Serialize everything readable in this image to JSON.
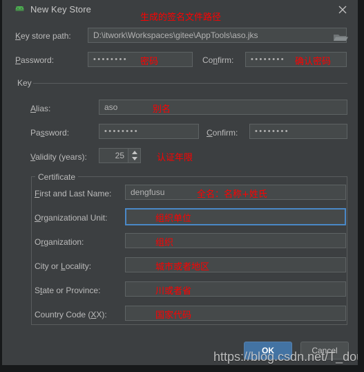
{
  "window": {
    "title": "New Key Store",
    "app_icon": "android-robot-icon",
    "close_icon": "close-icon"
  },
  "keystore": {
    "path_label": "Key store path:",
    "path_label_mnemonic": "K",
    "path_value": "D:\\itwork\\Workspaces\\gitee\\AppTools\\aso.jks",
    "path_annotation": "生成的签名文件路径",
    "browse_icon": "folder-icon",
    "password_label": "Password:",
    "password_label_mnemonic": "P",
    "password_value": "••••••••",
    "password_annotation": "密码",
    "confirm_label": "Confirm:",
    "confirm_label_mnemonic": "n",
    "confirm_value": "••••••••",
    "confirm_annotation": "确认密码"
  },
  "key": {
    "group_title": "Key",
    "alias_label": "Alias:",
    "alias_label_mnemonic": "A",
    "alias_value": "aso",
    "alias_annotation": "别名",
    "password_label": "Password:",
    "password_label_mnemonic": "s",
    "password_value": "••••••••",
    "confirm_label": "Confirm:",
    "confirm_label_mnemonic": "C",
    "confirm_value": "••••••••",
    "validity_label": "Validity (years):",
    "validity_label_mnemonic": "V",
    "validity_value": "25",
    "validity_annotation": "认证年限"
  },
  "certificate": {
    "group_title": "Certificate",
    "rows": [
      {
        "label": "First and Last Name:",
        "mnemonic": "F",
        "value": "dengfusu",
        "annotation": "全名：名称+姓氏",
        "focused": false
      },
      {
        "label": "Organizational Unit:",
        "mnemonic": "O",
        "value": "",
        "annotation": "组织单位",
        "focused": true
      },
      {
        "label": "Organization:",
        "mnemonic": "r",
        "value": "",
        "annotation": "组织",
        "focused": false
      },
      {
        "label": "City or Locality:",
        "mnemonic": "L",
        "value": "",
        "annotation": "城市或者地区",
        "focused": false
      },
      {
        "label": "State or Province:",
        "mnemonic": "t",
        "value": "",
        "annotation": "川或者省",
        "focused": false
      },
      {
        "label": "Country Code (XX):",
        "mnemonic": "X",
        "value": "",
        "annotation": "国家代码",
        "focused": false
      }
    ]
  },
  "footer": {
    "ok_label": "OK",
    "cancel_label": "Cancel",
    "watermark": "https://blog.csdn.net/T_double"
  },
  "colors": {
    "dialog_bg": "#3c3f41",
    "field_bg": "#45494a",
    "field_border": "#5e6364",
    "focus_border": "#4a88c7",
    "accent_button": "#4373a3",
    "annotation_red": "#ff0000",
    "android_green": "#4caf50"
  }
}
